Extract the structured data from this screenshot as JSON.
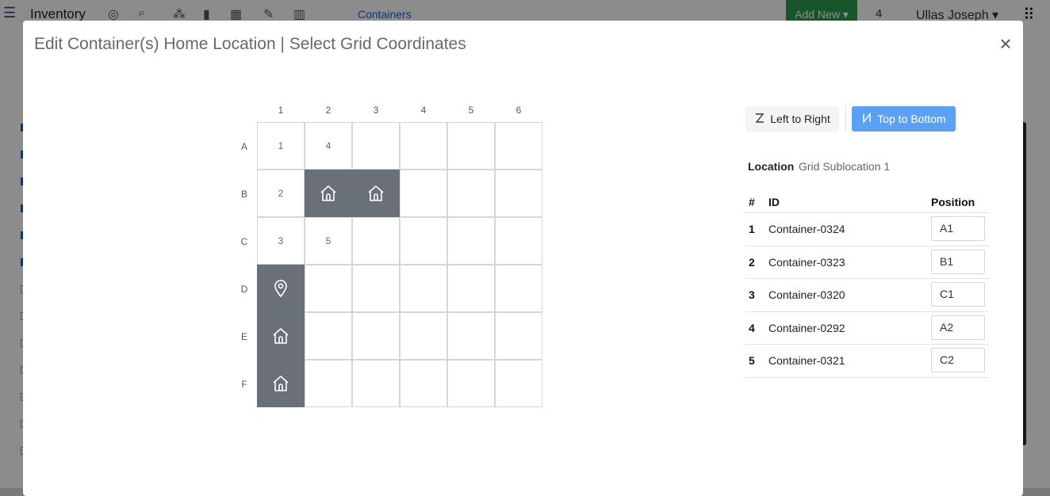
{
  "app": {
    "title": "Inventory",
    "nav_link": "Containers",
    "add_new_label": "Add New ▾",
    "notification_count": "4",
    "user_name": "Ullas Joseph ▾"
  },
  "modal": {
    "title": "Edit Container(s) Home Location | Select Grid Coordinates",
    "close_label": "×"
  },
  "grid": {
    "columns": [
      "1",
      "2",
      "3",
      "4",
      "5",
      "6"
    ],
    "rows": [
      "A",
      "B",
      "C",
      "D",
      "E",
      "F"
    ],
    "cells": {
      "A1": {
        "label": "1"
      },
      "A2": {
        "label": "4"
      },
      "B1": {
        "label": "2"
      },
      "B2": {
        "icon": "home-icon"
      },
      "B3": {
        "icon": "home-icon"
      },
      "C1": {
        "label": "3"
      },
      "C2": {
        "label": "5"
      },
      "D1": {
        "icon": "location-pin-icon"
      },
      "E1": {
        "icon": "home-icon"
      },
      "F1": {
        "icon": "home-icon"
      }
    }
  },
  "order_buttons": {
    "left_to_right": "Left to Right",
    "top_to_bottom": "Top to Bottom",
    "active": "top_to_bottom",
    "active_color": "#5aa1f4"
  },
  "location": {
    "label": "Location",
    "value": "Grid Sublocation 1"
  },
  "table": {
    "headers": [
      "#",
      "ID",
      "Position"
    ],
    "rows": [
      {
        "num": "1",
        "id": "Container-0324",
        "position": "A1"
      },
      {
        "num": "2",
        "id": "Container-0323",
        "position": "B1"
      },
      {
        "num": "3",
        "id": "Container-0320",
        "position": "C1"
      },
      {
        "num": "4",
        "id": "Container-0292",
        "position": "A2"
      },
      {
        "num": "5",
        "id": "Container-0321",
        "position": "C2"
      }
    ]
  }
}
